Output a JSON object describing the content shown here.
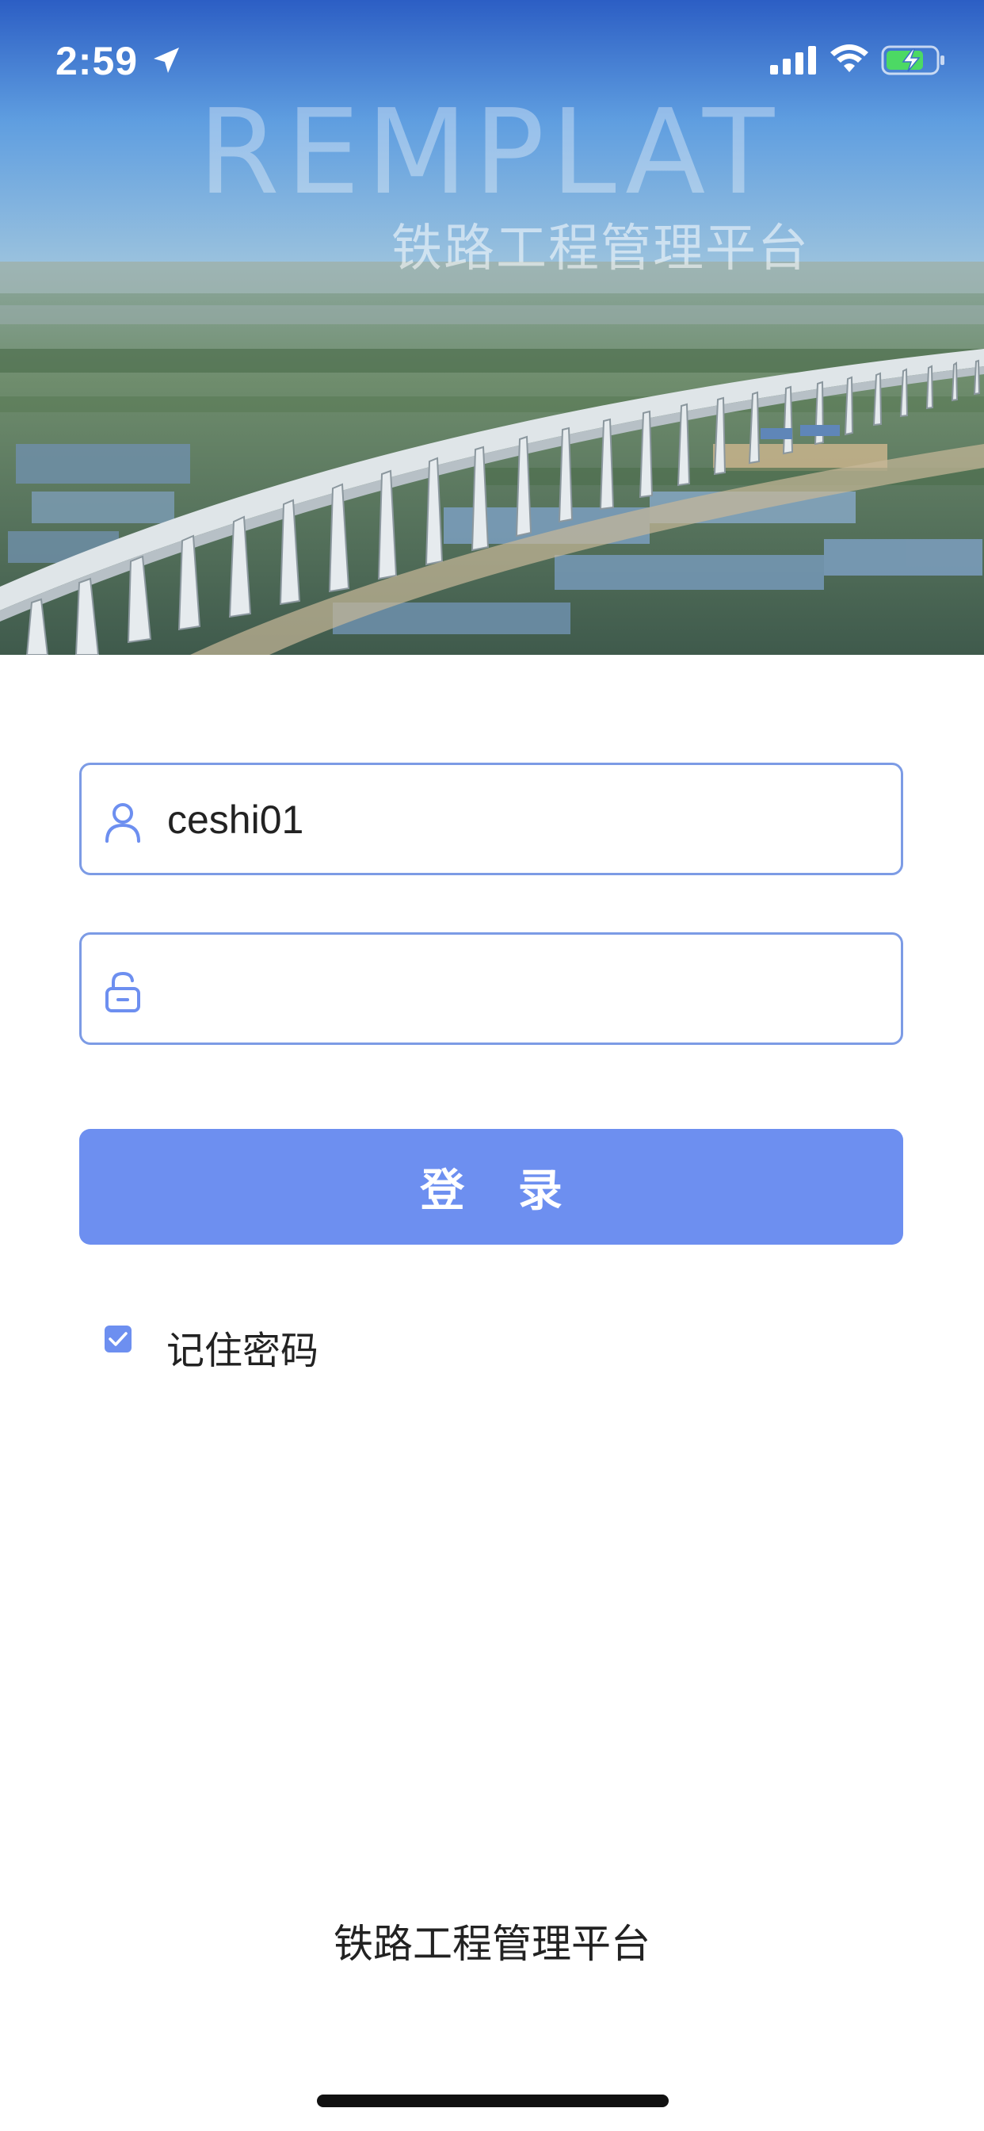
{
  "status_bar": {
    "time": "2:59",
    "location_icon": "location-arrow-icon",
    "signal_icon": "cellular-signal-icon",
    "wifi_icon": "wifi-icon",
    "battery_icon": "battery-charging-icon"
  },
  "hero": {
    "brand_en": "REMPLAT",
    "brand_cn": "铁路工程管理平台",
    "image_description": "elevated railway viaduct over farmland"
  },
  "login_form": {
    "username": {
      "icon": "user-icon",
      "value": "ceshi01"
    },
    "password": {
      "icon": "unlock-icon",
      "value": ""
    },
    "submit_label": "登 录",
    "remember": {
      "label": "记住密码",
      "checked": true
    }
  },
  "footer": {
    "text": "铁路工程管理平台"
  },
  "colors": {
    "accent": "#6d8ff0",
    "field_border": "#7c9be5"
  }
}
